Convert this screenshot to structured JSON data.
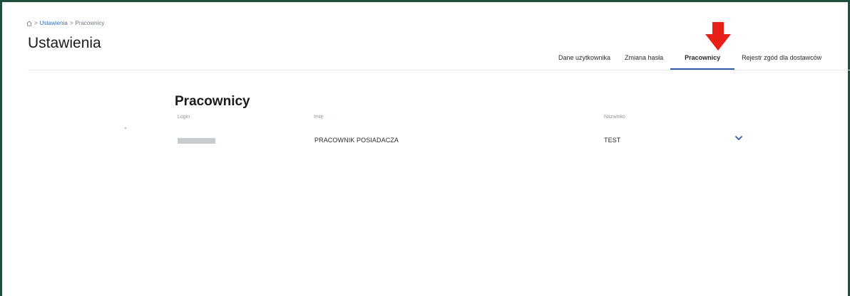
{
  "breadcrumb": {
    "home_icon": "home-icon",
    "separator": ">",
    "items": [
      "Ustawienia",
      "Pracownicy"
    ]
  },
  "page": {
    "title": "Ustawienia"
  },
  "tabs": [
    {
      "label": "Dane użytkownika",
      "active": false
    },
    {
      "label": "Zmiana hasła",
      "active": false
    },
    {
      "label": "Pracownicy",
      "active": true
    },
    {
      "label": "Rejestr zgód dla dostawców",
      "active": false
    }
  ],
  "annotation": {
    "icon": "red-arrow-down-icon",
    "color": "#e8201a"
  },
  "employees": {
    "title": "Pracownicy",
    "columns": {
      "login": "Login",
      "first_name": "Imię",
      "last_name": "Nazwisko"
    },
    "rows": [
      {
        "login": "",
        "first_name": "PRACOWNIK POSIADACZA",
        "last_name": "TEST",
        "expand_icon": "chevron-down-icon"
      }
    ]
  },
  "colors": {
    "accent": "#2e5aa8",
    "border": "#1f4f3a",
    "link": "#3d6fb0"
  }
}
